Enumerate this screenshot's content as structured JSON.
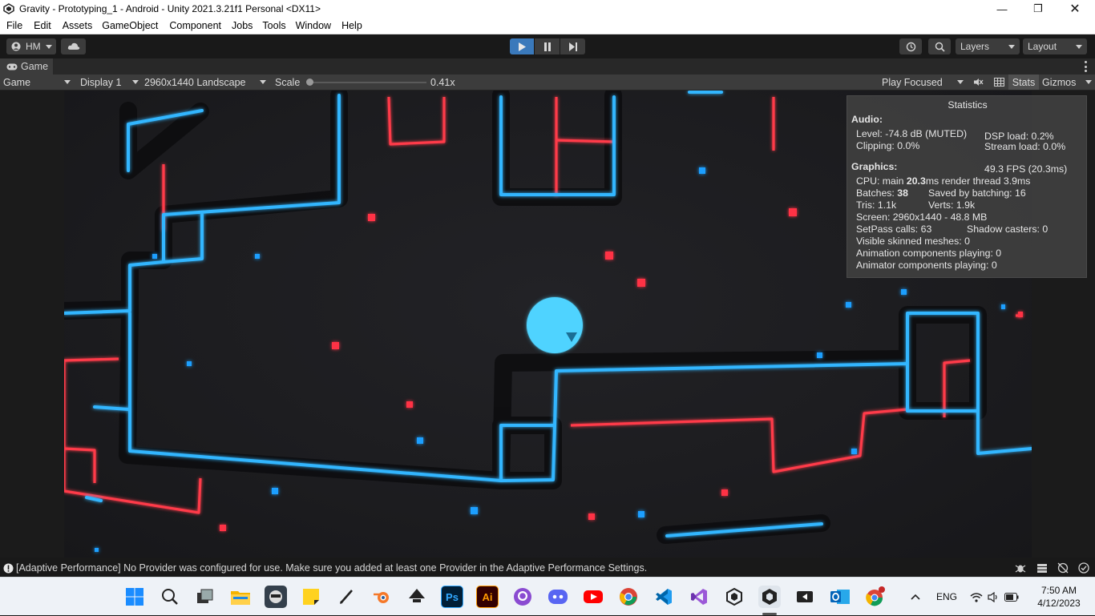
{
  "window": {
    "title": "Gravity - Prototyping_1 - Android - Unity 2021.3.21f1 Personal <DX11>",
    "controls": [
      "minimize-icon",
      "restore-icon",
      "close-icon"
    ]
  },
  "menu": [
    "File",
    "Edit",
    "Assets",
    "GameObject",
    "Component",
    "Jobs",
    "Tools",
    "Window",
    "Help"
  ],
  "toolbar": {
    "account": "HM",
    "layers": "Layers",
    "layout": "Layout"
  },
  "tab": {
    "label": "Game"
  },
  "gamebar": {
    "view": "Game",
    "display": "Display 1",
    "resolution": "2960x1440 Landscape",
    "scale_label": "Scale",
    "scale_value": "0.41x",
    "play_mode": "Play Focused",
    "stats": "Stats",
    "gizmos": "Gizmos"
  },
  "stats": {
    "title": "Statistics",
    "audio_header": "Audio:",
    "level": "Level: -74.8 dB (MUTED)",
    "dsp": "DSP load: 0.2%",
    "clipping": "Clipping: 0.0%",
    "stream": "Stream load: 0.0%",
    "graphics_header": "Graphics:",
    "fps": "49.3 FPS (20.3ms)",
    "cpu_prefix": "CPU: main ",
    "cpu_main": "20.3",
    "cpu_suffix": "ms  render thread 3.9ms",
    "batches_prefix": "Batches: ",
    "batches": "38",
    "saved": "Saved by batching: 16",
    "tris": "Tris: 1.1k",
    "verts": "Verts: 1.9k",
    "screen": "Screen: 2960x1440 - 48.8 MB",
    "setpass": "SetPass calls: 63",
    "shadow": "Shadow casters: 0",
    "skinned": "Visible skinned meshes: 0",
    "animation": "Animation components playing: 0",
    "animator": "Animator components playing: 0"
  },
  "status": {
    "message": "[Adaptive Performance] No Provider was configured for use. Make sure you added at least one Provider in the Adaptive Performance Settings."
  },
  "taskbar": {
    "apps": [
      "windows-start-icon",
      "search-icon",
      "task-view-icon",
      "file-explorer-icon",
      "game-app-icon",
      "sticky-notes-icon",
      "pen-icon",
      "blender-icon",
      "inkscape-icon",
      "photoshop-icon",
      "illustrator-icon",
      "github-desktop-icon",
      "discord-icon",
      "youtube-icon",
      "chrome-icon",
      "vscode-icon",
      "visual-studio-icon",
      "unity-hub-icon",
      "unity-editor-icon",
      "unity-player-icon",
      "outlook-icon",
      "chrome-profile-icon"
    ],
    "ps_label": "Ps",
    "ai_label": "Ai",
    "lang": "ENG",
    "time": "7:50 AM",
    "date": "4/12/2023"
  },
  "colors": {
    "blue_line": "#33b6ff",
    "red_line": "#ff3a4a",
    "player": "#4fd3ff",
    "play_active": "#3a79bb"
  }
}
